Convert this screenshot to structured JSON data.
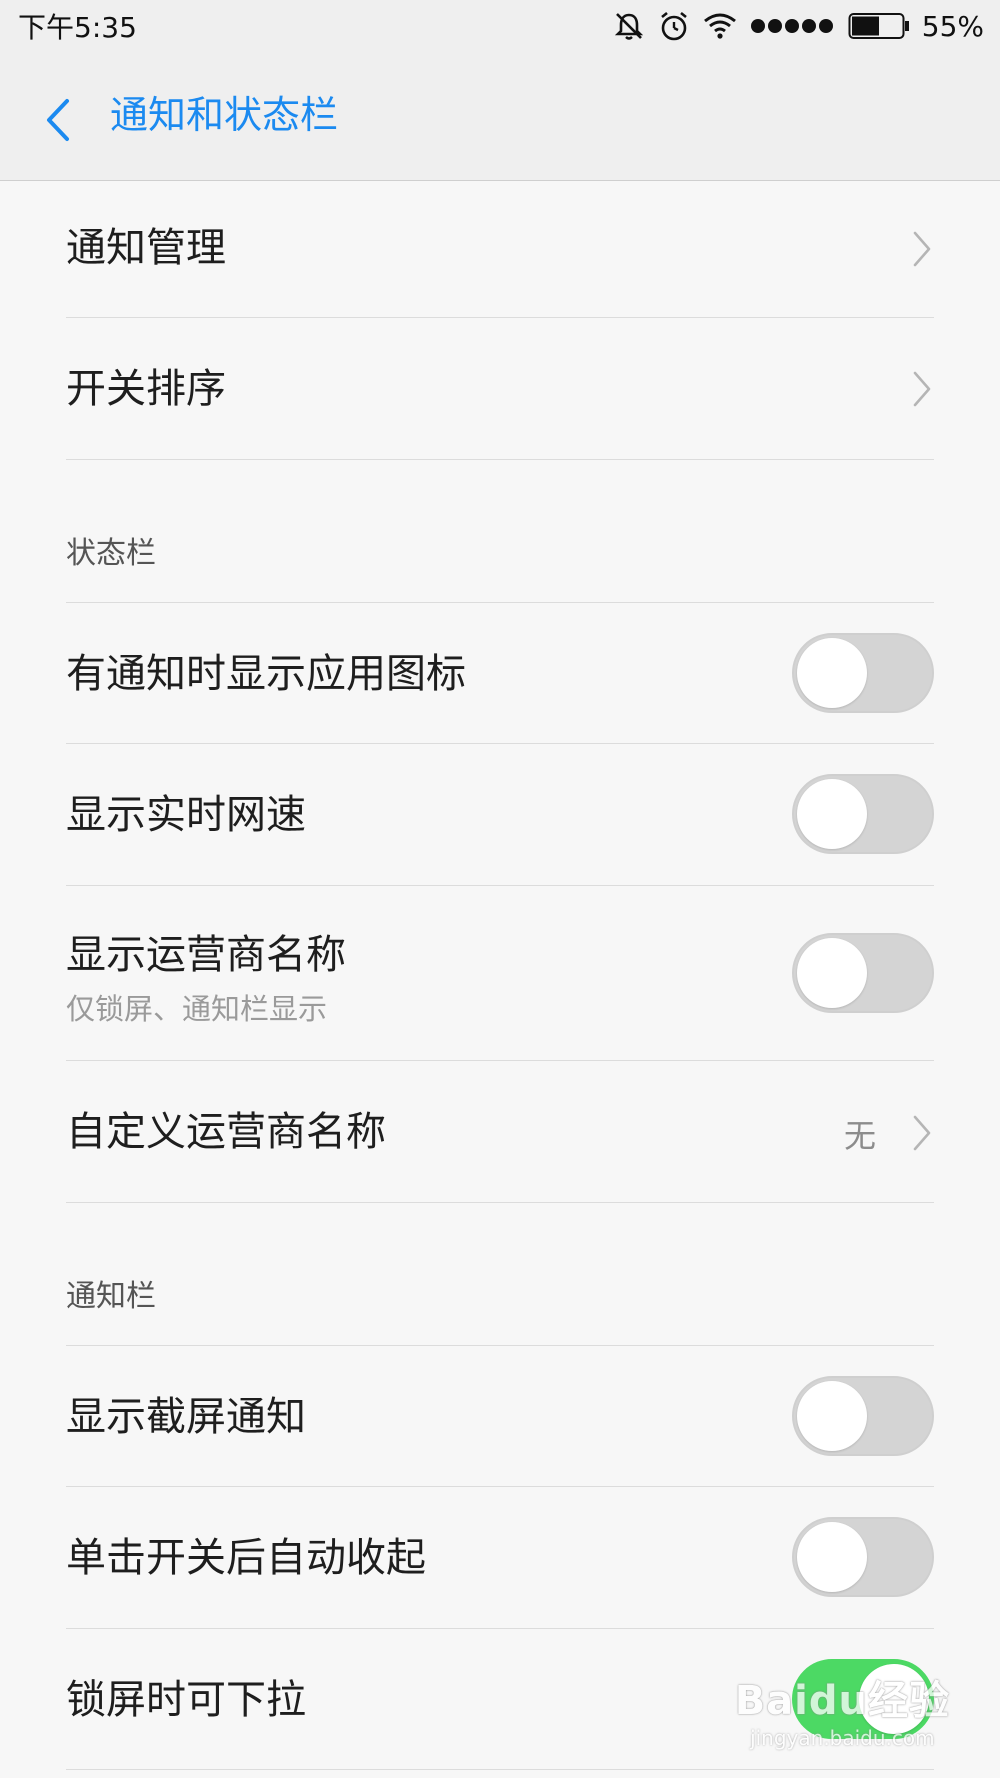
{
  "status_bar": {
    "time": "下午5:35",
    "battery_percent": "55%",
    "battery_level": 0.55,
    "icons": [
      "mute-icon",
      "alarm-icon",
      "wifi-icon",
      "signal-icon",
      "battery-icon"
    ]
  },
  "header": {
    "title": "通知和状态栏",
    "back_icon": "chevron-left-icon",
    "accent_color": "#1b8af0"
  },
  "rows_top": [
    {
      "label": "通知管理"
    },
    {
      "label": "开关排序"
    }
  ],
  "status_section": {
    "title": "状态栏",
    "items": [
      {
        "label": "有通知时显示应用图标",
        "on": false
      },
      {
        "label": "显示实时网速",
        "on": false
      },
      {
        "label": "显示运营商名称",
        "sub": "仅锁屏、通知栏显示",
        "on": false
      }
    ],
    "custom_carrier": {
      "label": "自定义运营商名称",
      "value": "无"
    }
  },
  "notification_section": {
    "title": "通知栏",
    "items": [
      {
        "label": "显示截屏通知",
        "on": false
      },
      {
        "label": "单击开关后自动收起",
        "on": false
      },
      {
        "label": "锁屏时可下拉",
        "on": true
      }
    ]
  },
  "watermark": {
    "main": "Baidu经验",
    "sub": "jingyan.baidu.com"
  },
  "colors": {
    "toggle_on": "#4cd964",
    "toggle_off": "#d4d4d4",
    "background": "#f7f7f7"
  }
}
